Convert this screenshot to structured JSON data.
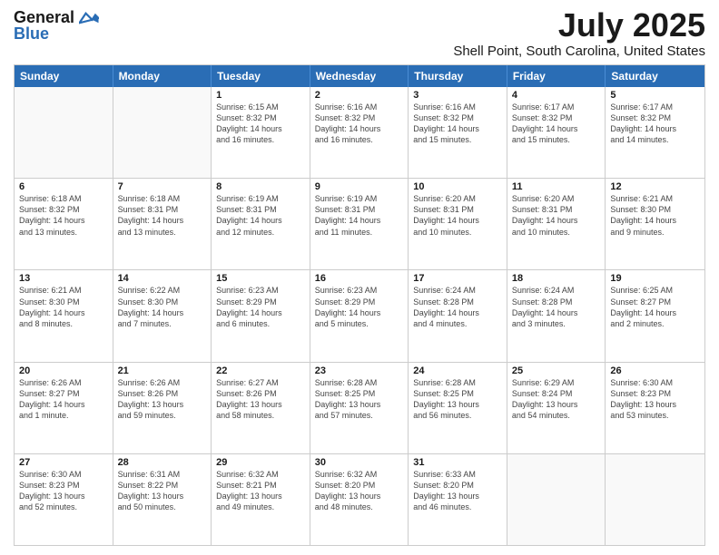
{
  "header": {
    "logo_line1": "General",
    "logo_line2": "Blue",
    "month": "July 2025",
    "location": "Shell Point, South Carolina, United States"
  },
  "weekdays": [
    "Sunday",
    "Monday",
    "Tuesday",
    "Wednesday",
    "Thursday",
    "Friday",
    "Saturday"
  ],
  "rows": [
    [
      {
        "day": "",
        "info": ""
      },
      {
        "day": "",
        "info": ""
      },
      {
        "day": "1",
        "info": "Sunrise: 6:15 AM\nSunset: 8:32 PM\nDaylight: 14 hours\nand 16 minutes."
      },
      {
        "day": "2",
        "info": "Sunrise: 6:16 AM\nSunset: 8:32 PM\nDaylight: 14 hours\nand 16 minutes."
      },
      {
        "day": "3",
        "info": "Sunrise: 6:16 AM\nSunset: 8:32 PM\nDaylight: 14 hours\nand 15 minutes."
      },
      {
        "day": "4",
        "info": "Sunrise: 6:17 AM\nSunset: 8:32 PM\nDaylight: 14 hours\nand 15 minutes."
      },
      {
        "day": "5",
        "info": "Sunrise: 6:17 AM\nSunset: 8:32 PM\nDaylight: 14 hours\nand 14 minutes."
      }
    ],
    [
      {
        "day": "6",
        "info": "Sunrise: 6:18 AM\nSunset: 8:32 PM\nDaylight: 14 hours\nand 13 minutes."
      },
      {
        "day": "7",
        "info": "Sunrise: 6:18 AM\nSunset: 8:31 PM\nDaylight: 14 hours\nand 13 minutes."
      },
      {
        "day": "8",
        "info": "Sunrise: 6:19 AM\nSunset: 8:31 PM\nDaylight: 14 hours\nand 12 minutes."
      },
      {
        "day": "9",
        "info": "Sunrise: 6:19 AM\nSunset: 8:31 PM\nDaylight: 14 hours\nand 11 minutes."
      },
      {
        "day": "10",
        "info": "Sunrise: 6:20 AM\nSunset: 8:31 PM\nDaylight: 14 hours\nand 10 minutes."
      },
      {
        "day": "11",
        "info": "Sunrise: 6:20 AM\nSunset: 8:31 PM\nDaylight: 14 hours\nand 10 minutes."
      },
      {
        "day": "12",
        "info": "Sunrise: 6:21 AM\nSunset: 8:30 PM\nDaylight: 14 hours\nand 9 minutes."
      }
    ],
    [
      {
        "day": "13",
        "info": "Sunrise: 6:21 AM\nSunset: 8:30 PM\nDaylight: 14 hours\nand 8 minutes."
      },
      {
        "day": "14",
        "info": "Sunrise: 6:22 AM\nSunset: 8:30 PM\nDaylight: 14 hours\nand 7 minutes."
      },
      {
        "day": "15",
        "info": "Sunrise: 6:23 AM\nSunset: 8:29 PM\nDaylight: 14 hours\nand 6 minutes."
      },
      {
        "day": "16",
        "info": "Sunrise: 6:23 AM\nSunset: 8:29 PM\nDaylight: 14 hours\nand 5 minutes."
      },
      {
        "day": "17",
        "info": "Sunrise: 6:24 AM\nSunset: 8:28 PM\nDaylight: 14 hours\nand 4 minutes."
      },
      {
        "day": "18",
        "info": "Sunrise: 6:24 AM\nSunset: 8:28 PM\nDaylight: 14 hours\nand 3 minutes."
      },
      {
        "day": "19",
        "info": "Sunrise: 6:25 AM\nSunset: 8:27 PM\nDaylight: 14 hours\nand 2 minutes."
      }
    ],
    [
      {
        "day": "20",
        "info": "Sunrise: 6:26 AM\nSunset: 8:27 PM\nDaylight: 14 hours\nand 1 minute."
      },
      {
        "day": "21",
        "info": "Sunrise: 6:26 AM\nSunset: 8:26 PM\nDaylight: 13 hours\nand 59 minutes."
      },
      {
        "day": "22",
        "info": "Sunrise: 6:27 AM\nSunset: 8:26 PM\nDaylight: 13 hours\nand 58 minutes."
      },
      {
        "day": "23",
        "info": "Sunrise: 6:28 AM\nSunset: 8:25 PM\nDaylight: 13 hours\nand 57 minutes."
      },
      {
        "day": "24",
        "info": "Sunrise: 6:28 AM\nSunset: 8:25 PM\nDaylight: 13 hours\nand 56 minutes."
      },
      {
        "day": "25",
        "info": "Sunrise: 6:29 AM\nSunset: 8:24 PM\nDaylight: 13 hours\nand 54 minutes."
      },
      {
        "day": "26",
        "info": "Sunrise: 6:30 AM\nSunset: 8:23 PM\nDaylight: 13 hours\nand 53 minutes."
      }
    ],
    [
      {
        "day": "27",
        "info": "Sunrise: 6:30 AM\nSunset: 8:23 PM\nDaylight: 13 hours\nand 52 minutes."
      },
      {
        "day": "28",
        "info": "Sunrise: 6:31 AM\nSunset: 8:22 PM\nDaylight: 13 hours\nand 50 minutes."
      },
      {
        "day": "29",
        "info": "Sunrise: 6:32 AM\nSunset: 8:21 PM\nDaylight: 13 hours\nand 49 minutes."
      },
      {
        "day": "30",
        "info": "Sunrise: 6:32 AM\nSunset: 8:20 PM\nDaylight: 13 hours\nand 48 minutes."
      },
      {
        "day": "31",
        "info": "Sunrise: 6:33 AM\nSunset: 8:20 PM\nDaylight: 13 hours\nand 46 minutes."
      },
      {
        "day": "",
        "info": ""
      },
      {
        "day": "",
        "info": ""
      }
    ]
  ]
}
